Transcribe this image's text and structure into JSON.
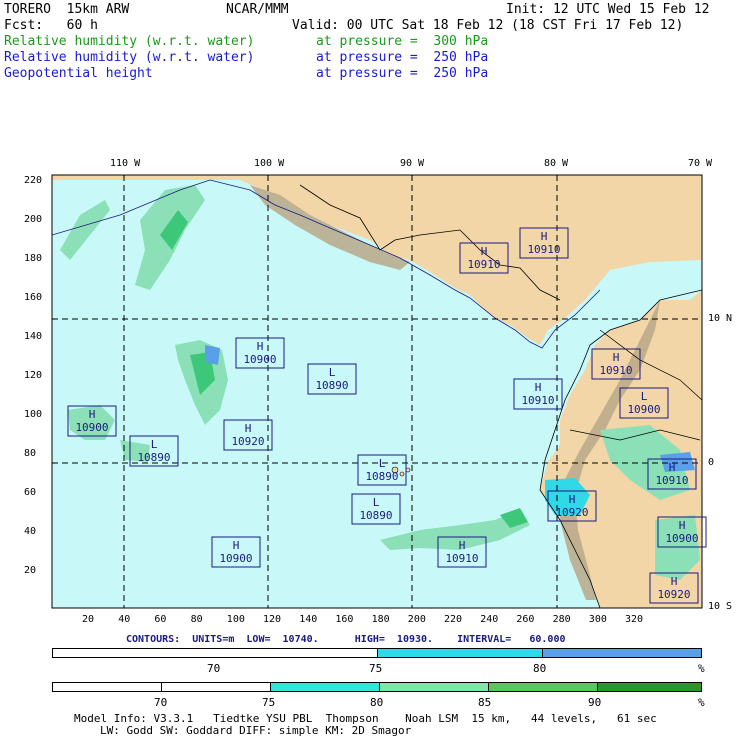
{
  "header": {
    "model": "TORERO  15km ARW",
    "center": "NCAR/MMM",
    "init": "Init: 12 UTC Wed 15 Feb 12",
    "fcst": "Fcst:   60 h",
    "valid": "Valid: 00 UTC Sat 18 Feb 12 (18 CST Fri 17 Feb 12)",
    "field1_name": "Relative humidity (w.r.t. water)",
    "field1_level": "at pressure =  300 hPa",
    "field2_name": "Relative humidity (w.r.t. water)",
    "field2_level": "at pressure =  250 hPa",
    "field3_name": "Geopotential height",
    "field3_level": "at pressure =  250 hPa",
    "field1_color": "#1a9a1a",
    "field2_color": "#1a1ad0"
  },
  "map": {
    "top_lon_labels": [
      "110 W",
      "100 W",
      "90 W",
      "80 W",
      "70 W"
    ],
    "right_lat_labels": [
      "10 N",
      "0",
      "10 S"
    ],
    "y_ticks": [
      "220",
      "200",
      "180",
      "160",
      "140",
      "120",
      "100",
      "80",
      "60",
      "40",
      "20"
    ],
    "x_ticks": [
      "20",
      "40",
      "60",
      "80",
      "100",
      "120",
      "140",
      "160",
      "180",
      "200",
      "220",
      "240",
      "260",
      "280",
      "300",
      "320"
    ],
    "highs_lows": [
      {
        "type": "H",
        "value": "10910"
      },
      {
        "type": "H",
        "value": "10910"
      },
      {
        "type": "H",
        "value": "10900"
      },
      {
        "type": "L",
        "value": "10890"
      },
      {
        "type": "H",
        "value": "10910"
      },
      {
        "type": "H",
        "value": "10910"
      },
      {
        "type": "H",
        "value": "10900"
      },
      {
        "type": "L",
        "value": "10900"
      },
      {
        "type": "H",
        "value": "10920"
      },
      {
        "type": "L",
        "value": "10890"
      },
      {
        "type": "L",
        "value": "10890"
      },
      {
        "type": "H",
        "value": "10910"
      },
      {
        "type": "L",
        "value": "10890"
      },
      {
        "type": "H",
        "value": "10920"
      },
      {
        "type": "H",
        "value": "10900"
      },
      {
        "type": "H",
        "value": "10910"
      },
      {
        "type": "H",
        "value": "10900"
      },
      {
        "type": "H",
        "value": "10920"
      }
    ],
    "colors": {
      "ocean": "#c8f8f8",
      "land": "#f2d6a8",
      "mountain": "#b8a888",
      "rh_light": "#8ce0b8",
      "rh_mid": "#3cc878",
      "rh_dark": "#1a9a3a",
      "rh_blue": "#5aa0e8",
      "rh_cyan": "#30d8e8"
    }
  },
  "contour_info": "CONTOURS:  UNITS=m  LOW=  10740.      HIGH=  10930.    INTERVAL=   60.000",
  "legend1": {
    "labels": [
      "70",
      "75",
      "80"
    ],
    "unit": "%",
    "colors": [
      "#ffffff",
      "#30d8e8",
      "#5aa0e8"
    ]
  },
  "legend2": {
    "labels": [
      "70",
      "75",
      "80",
      "85",
      "90"
    ],
    "unit": "%",
    "colors": [
      "#ffffff",
      "#30e8d8",
      "#7ce8a8",
      "#58c858",
      "#289828"
    ]
  },
  "footer": {
    "line1": "Model Info: V3.3.1   Tiedtke YSU PBL  Thompson    Noah LSM  15 km,   44 levels,   61 sec",
    "line2": "LW: Godd SW: Goddard DIFF: simple KM: 2D Smagor"
  }
}
